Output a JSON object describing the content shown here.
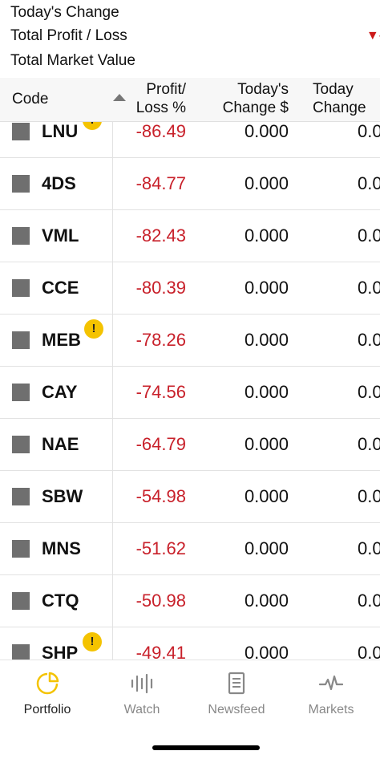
{
  "summary": {
    "todays_change_label": "Today's Change",
    "total_profit_loss_label": "Total Profit / Loss",
    "total_market_value_label": "Total Market Value",
    "loss_indicator": "▼-"
  },
  "table": {
    "headers": {
      "code": "Code",
      "profit_loss_line1": "Profit/",
      "profit_loss_line2": "Loss %",
      "todays_change_line1": "Today's",
      "todays_change_line2": "Change $",
      "todays_change_pct_line1": "Today",
      "todays_change_pct_line2": "Change"
    },
    "rows": [
      {
        "code": "LNU",
        "warning": "!",
        "profit_loss": "-86.49",
        "todays_change": "0.000",
        "todays_change_pct": "0.0"
      },
      {
        "code": "4DS",
        "warning": "",
        "profit_loss": "-84.77",
        "todays_change": "0.000",
        "todays_change_pct": "0.0"
      },
      {
        "code": "VML",
        "warning": "",
        "profit_loss": "-82.43",
        "todays_change": "0.000",
        "todays_change_pct": "0.0"
      },
      {
        "code": "CCE",
        "warning": "",
        "profit_loss": "-80.39",
        "todays_change": "0.000",
        "todays_change_pct": "0.0"
      },
      {
        "code": "MEB",
        "warning": "!",
        "profit_loss": "-78.26",
        "todays_change": "0.000",
        "todays_change_pct": "0.0"
      },
      {
        "code": "CAY",
        "warning": "",
        "profit_loss": "-74.56",
        "todays_change": "0.000",
        "todays_change_pct": "0.0"
      },
      {
        "code": "NAE",
        "warning": "",
        "profit_loss": "-64.79",
        "todays_change": "0.000",
        "todays_change_pct": "0.0"
      },
      {
        "code": "SBW",
        "warning": "",
        "profit_loss": "-54.98",
        "todays_change": "0.000",
        "todays_change_pct": "0.0"
      },
      {
        "code": "MNS",
        "warning": "",
        "profit_loss": "-51.62",
        "todays_change": "0.000",
        "todays_change_pct": "0.0"
      },
      {
        "code": "CTQ",
        "warning": "",
        "profit_loss": "-50.98",
        "todays_change": "0.000",
        "todays_change_pct": "0.0"
      },
      {
        "code": "SHP",
        "warning": "!",
        "profit_loss": "-49.41",
        "todays_change": "0.000",
        "todays_change_pct": "0.0"
      }
    ]
  },
  "tabs": [
    {
      "label": "Portfolio",
      "icon": "pie-chart-icon",
      "active": true
    },
    {
      "label": "Watch",
      "icon": "bars-icon",
      "active": false
    },
    {
      "label": "Newsfeed",
      "icon": "document-icon",
      "active": false
    },
    {
      "label": "Markets",
      "icon": "pulse-icon",
      "active": false
    }
  ],
  "colors": {
    "loss": "#c8202a",
    "accent": "#f4c300",
    "swatch": "#6f6f6f"
  }
}
